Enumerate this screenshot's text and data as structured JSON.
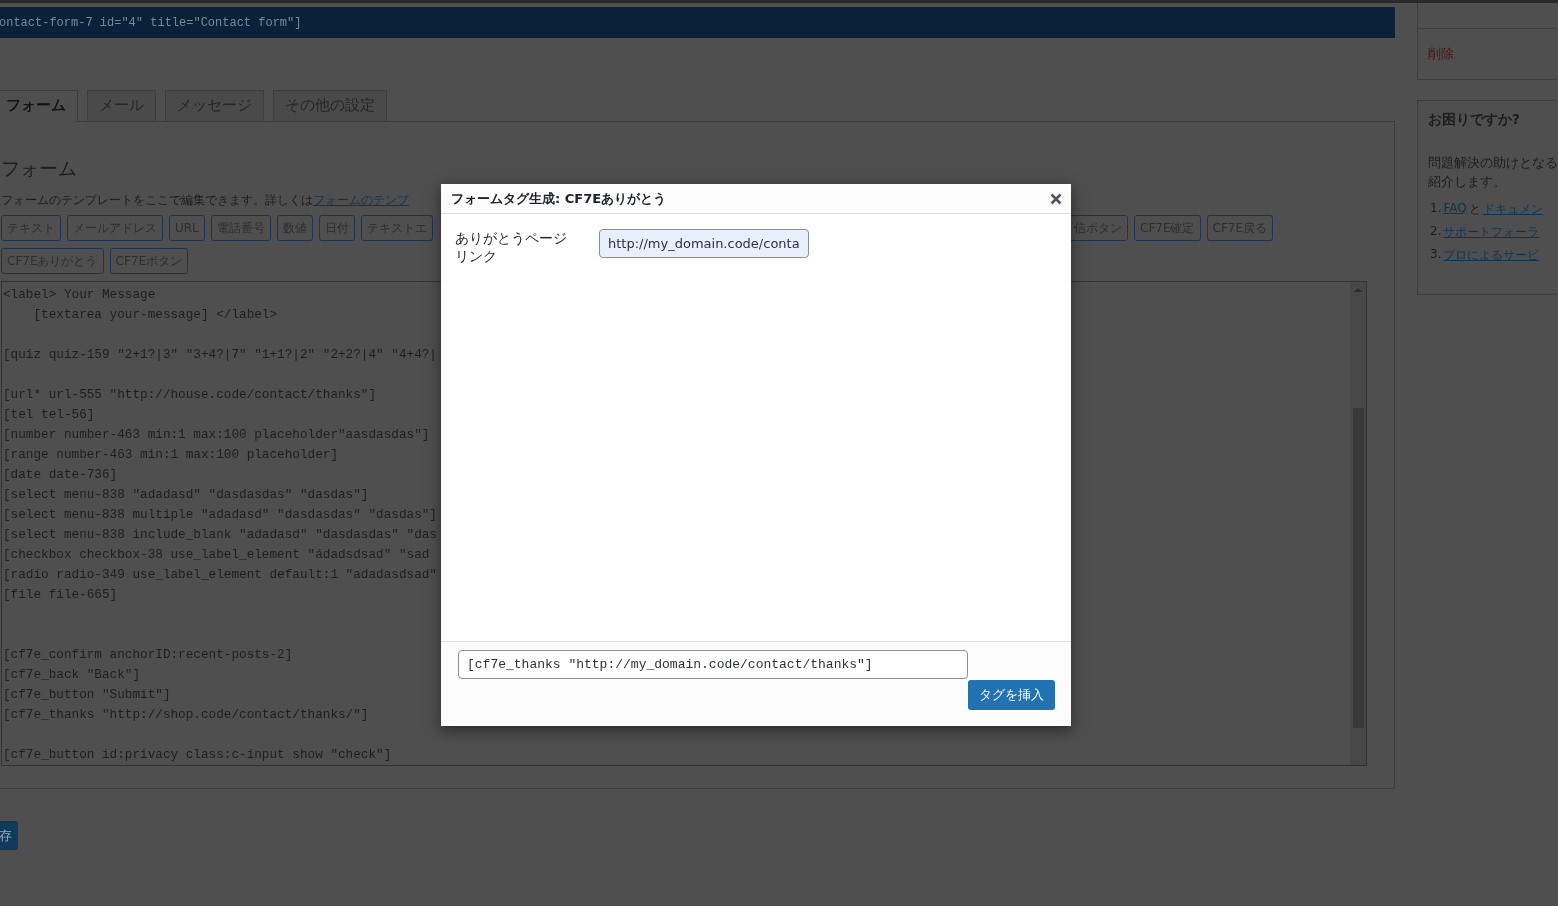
{
  "shortcode": "ontact-form-7 id=\"4\" title=\"Contact form\"]",
  "tabs": [
    {
      "label": "フォーム",
      "selected": true
    },
    {
      "label": "メール",
      "selected": false
    },
    {
      "label": "メッセージ",
      "selected": false
    },
    {
      "label": "その他の設定",
      "selected": false
    }
  ],
  "form_panel": {
    "heading": "フォーム",
    "description": "フォームのテンプレートをここで編集できます。詳しくは",
    "description_link": "フォームのテンプ",
    "tag_buttons_row1_left": [
      "テキスト",
      "メールアドレス",
      "URL",
      "電話番号",
      "数値",
      "日付",
      "テキストエ"
    ],
    "tag_buttons_row1_right": [
      "信ボタン",
      "CF7E確定",
      "CF7E戻る"
    ],
    "tag_buttons_row2": [
      "CF7Eありがとう",
      "CF7Eボタン"
    ],
    "editor_text": "<label> Your Message\n    [textarea your-message] </label>\n\n[quiz quiz-159 \"2+1?|3\" \"3+4?|7\" \"1+1?|2\" \"2+2?|4\" \"4+4?|\n\n[url* url-555 \"http://house.code/contact/thanks\"]\n[tel tel-56]\n[number number-463 min:1 max:100 placeholder\"aasdasdas\"]\n[range number-463 min:1 max:100 placeholder]\n[date date-736]\n[select menu-838 \"adadasd\" \"dasdasdas\" \"dasdas\"]\n[select menu-838 multiple \"adadasd\" \"dasdasdas\" \"dasdas\"]\n[select menu-838 include_blank \"adadasd\" \"dasdasdas\" \"das\n[checkbox checkbox-38 use_label_element \"ádadsdsad\" \"sad\n[radio radio-349 use_label_element default:1 \"adadasdsad\"\n[file file-665]\n\n\n[cf7e_confirm anchorID:recent-posts-2]\n[cf7e_back \"Back\"]\n[cf7e_button \"Submit\"]\n[cf7e_thanks \"http://shop.code/contact/thanks/\"]\n\n[cf7e_button id:privacy class:c-input show \"check\"]"
  },
  "save_button": "存",
  "sidebar": {
    "delete_link": "削除",
    "help": {
      "title": "お困りですか?",
      "text_lines": [
        "問題解決の助けとなる",
        "紹介します。"
      ],
      "links": [
        {
          "number": "1.",
          "parts": [
            {
              "text": "FAQ",
              "link": true
            },
            {
              "text": "と",
              "link": false
            },
            {
              "text": "ドキュメン",
              "link": true
            }
          ]
        },
        {
          "number": "2.",
          "parts": [
            {
              "text": "サポートフォーラ",
              "link": true
            }
          ]
        },
        {
          "number": "3.",
          "parts": [
            {
              "text": "プロによるサービ",
              "link": true
            }
          ]
        }
      ]
    }
  },
  "dialog": {
    "title": "フォームタグ生成: CF7Eありがとう",
    "field_label": "ありがとうページリンク",
    "field_value": "http://my_domain.code/conta",
    "tag_output": "[cf7e_thanks \"http://my_domain.code/contact/thanks\"]",
    "insert_button": "タグを挿入"
  }
}
